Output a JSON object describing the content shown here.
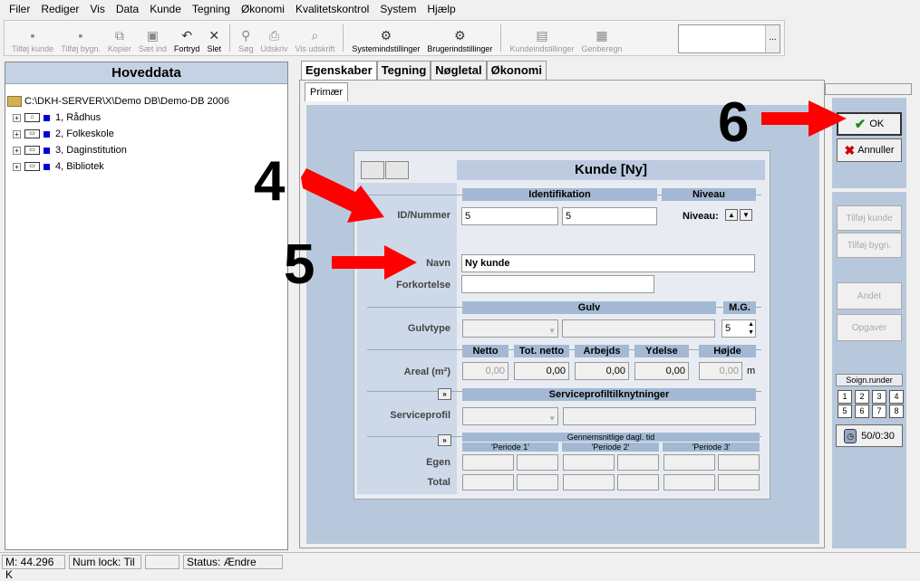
{
  "menu": [
    "Filer",
    "Rediger",
    "Vis",
    "Data",
    "Kunde",
    "Tegning",
    "Økonomi",
    "Kvalitetskontrol",
    "System",
    "Hjælp"
  ],
  "toolbar": {
    "buttons": [
      {
        "label": "Tilføj kunde",
        "icon": "add-customer-icon",
        "glyph": "▪"
      },
      {
        "label": "Tilføj bygn.",
        "icon": "add-building-icon",
        "glyph": "▪"
      },
      {
        "label": "Kopier",
        "icon": "copy-icon",
        "glyph": "⧉"
      },
      {
        "label": "Sæt ind",
        "icon": "paste-icon",
        "glyph": "▣"
      },
      {
        "label": "Fortryd",
        "icon": "undo-icon",
        "glyph": "↶"
      },
      {
        "label": "Slet",
        "icon": "delete-icon",
        "glyph": "✕"
      },
      {
        "label": "Søg",
        "icon": "search-icon",
        "glyph": "⚲"
      },
      {
        "label": "Udskriv",
        "icon": "print-icon",
        "glyph": "⎙"
      },
      {
        "label": "Vis udskrift",
        "icon": "print-preview-icon",
        "glyph": "⌕"
      },
      {
        "label": "Systemindstillinger",
        "icon": "system-settings-icon",
        "glyph": "⚙"
      },
      {
        "label": "Brugerindstillinger",
        "icon": "user-settings-icon",
        "glyph": "⚙"
      },
      {
        "label": "Kundeindstillinger",
        "icon": "customer-settings-icon",
        "glyph": "▤"
      },
      {
        "label": "Genberegn",
        "icon": "recalculate-icon",
        "glyph": "▦"
      }
    ],
    "combo_button": "..."
  },
  "left": {
    "title": "Hoveddata",
    "root": "C:\\DKH-SERVER\\X\\Demo DB\\Demo-DB 2006",
    "items": [
      "1, Rådhus",
      "2, Folkeskole",
      "3, Daginstitution",
      "4, Bibliotek"
    ]
  },
  "tabs": [
    "Egenskaber",
    "Tegning",
    "Nøgletal",
    "Økonomi"
  ],
  "subtab": "Primær",
  "form": {
    "title": "Kunde [Ny]",
    "identifikation": "Identifikation",
    "niveau_head": "Niveau",
    "id_label": "ID/Nummer",
    "id1": "5",
    "id2": "5",
    "niveau_label": "Niveau:",
    "navn_label": "Navn",
    "navn_value": "Ny kunde",
    "forkortelse_label": "Forkortelse",
    "gulv_head": "Gulv",
    "mg_head": "M.G.",
    "gulvtype_label": "Gulvtype",
    "mg_value": "5",
    "areal_heads": [
      "Netto",
      "Tot. netto",
      "Arbejds",
      "Ydelse",
      "Højde"
    ],
    "areal_label": "Areal (m²)",
    "areal_values": [
      "0,00",
      "0,00",
      "0,00",
      "0,00",
      "0,00"
    ],
    "unit_m": "m",
    "service_head": "Serviceprofiltilknytninger",
    "serviceprofil_label": "Serviceprofil",
    "expand_glyph": "»",
    "gennemsnit_head": "Gennemsnitlige dagl. tid",
    "perioder": [
      "'Periode 1'",
      "'Periode 2'",
      "'Periode 3'"
    ],
    "egen_label": "Egen",
    "total_label": "Total"
  },
  "right": {
    "ok": "OK",
    "annuller": "Annuller",
    "disabled_buttons": [
      "Tilføj kunde",
      "Tilføj bygn.",
      "Andet",
      "Opgaver"
    ],
    "soign_label": "Soign.runder",
    "grid": [
      "1",
      "2",
      "3",
      "4",
      "5",
      "6",
      "7",
      "8"
    ],
    "timer": "50/0:30"
  },
  "annotations": [
    "4",
    "5",
    "6"
  ],
  "colors": {
    "arrow": "#ff0000",
    "panel_blue": "#b8c8dc",
    "header_blue": "#a3b9d3"
  },
  "status": [
    "M: 44.296 K",
    "Num lock: Til",
    "",
    "Status: Ændre"
  ]
}
